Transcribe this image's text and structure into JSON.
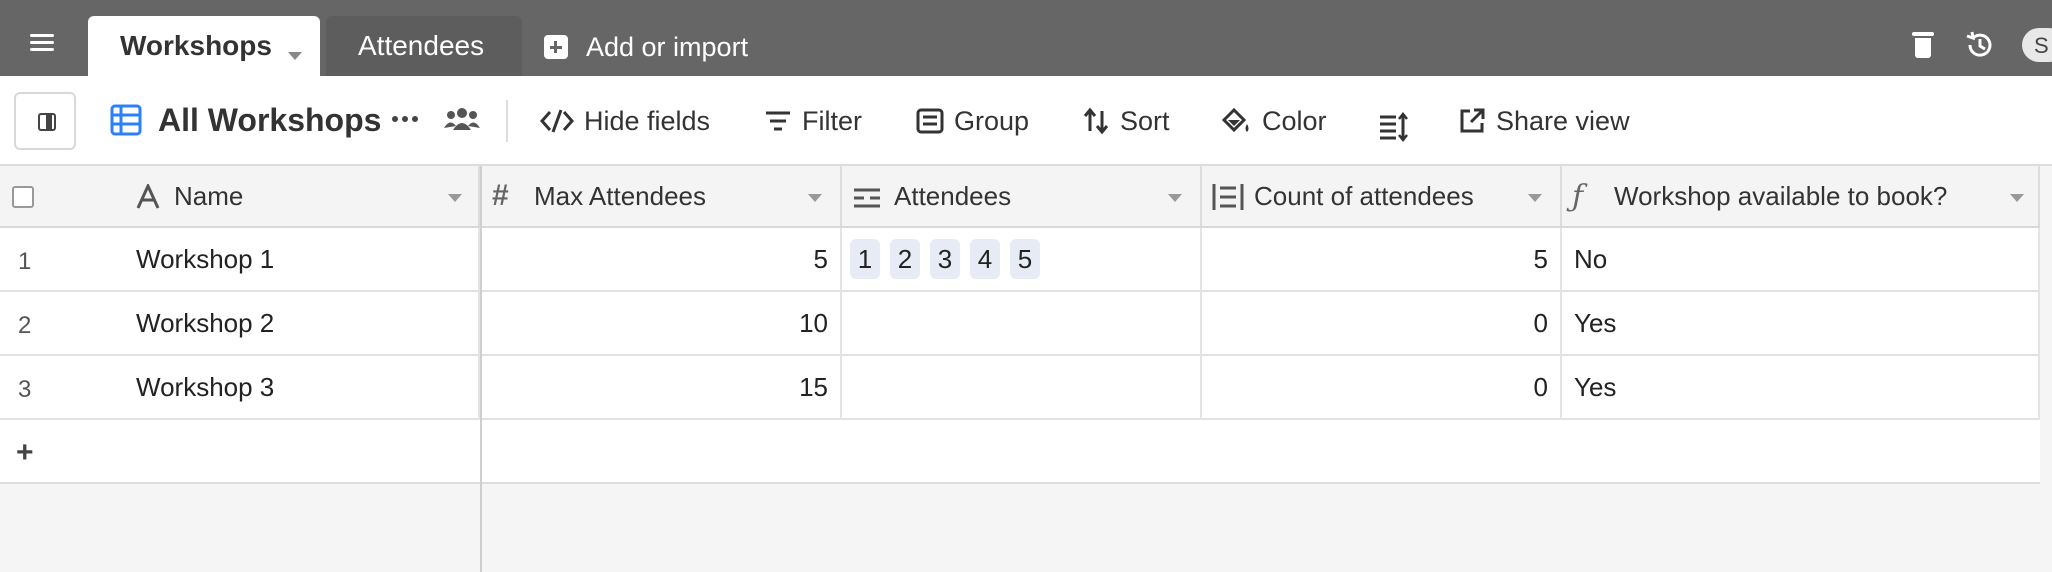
{
  "topbar": {
    "tabs": [
      {
        "label": "Workshops",
        "active": true
      },
      {
        "label": "Attendees",
        "active": false
      }
    ],
    "add_import_label": "Add or import",
    "avatar_initial": "S"
  },
  "toolbar": {
    "view_name": "All Workshops",
    "buttons": {
      "hide_fields": "Hide fields",
      "filter": "Filter",
      "group": "Group",
      "sort": "Sort",
      "color": "Color",
      "share_view": "Share view"
    }
  },
  "grid": {
    "columns": [
      {
        "name": "Name",
        "type": "text"
      },
      {
        "name": "Max Attendees",
        "type": "number"
      },
      {
        "name": "Attendees",
        "type": "linked"
      },
      {
        "name": "Count of attendees",
        "type": "count"
      },
      {
        "name": "Workshop available to book?",
        "type": "formula"
      }
    ],
    "rows": [
      {
        "num": "1",
        "name": "Workshop 1",
        "max": "5",
        "attendees": [
          "1",
          "2",
          "3",
          "4",
          "5"
        ],
        "count": "5",
        "available": "No"
      },
      {
        "num": "2",
        "name": "Workshop 2",
        "max": "10",
        "attendees": [],
        "count": "0",
        "available": "Yes"
      },
      {
        "num": "3",
        "name": "Workshop 3",
        "max": "15",
        "attendees": [],
        "count": "0",
        "available": "Yes"
      }
    ],
    "add_row_label": "+"
  },
  "colors": {
    "topbar_bg": "#666666",
    "accent_blue": "#2d7ff9",
    "chip_bg": "#e6ebf5"
  },
  "icons": [
    "menu-icon",
    "plus-square-icon",
    "trash-icon",
    "history-icon",
    "grid-view-icon",
    "more-icon",
    "people-icon",
    "hide-fields-icon",
    "filter-icon",
    "group-icon",
    "sort-icon",
    "color-bucket-icon",
    "row-height-icon",
    "share-icon"
  ]
}
